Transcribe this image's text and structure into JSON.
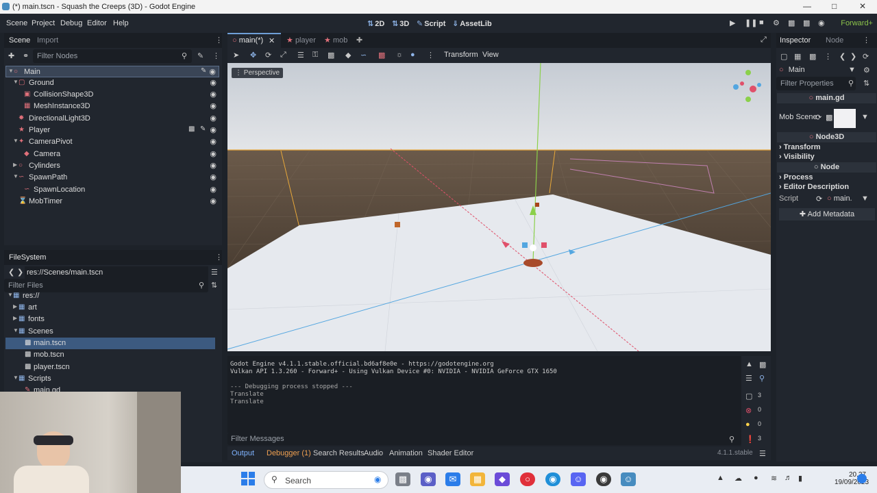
{
  "window": {
    "title": "(*) main.tscn - Squash the Creeps (3D) - Godot Engine"
  },
  "menu": {
    "items": [
      "Scene",
      "Project",
      "Debug",
      "Editor",
      "Help"
    ]
  },
  "workspaces": {
    "twod": "2D",
    "threed": "3D",
    "script": "Script",
    "assetlib": "AssetLib"
  },
  "renderer": "Forward+",
  "scene_dock": {
    "tabs": [
      "Scene",
      "Import"
    ],
    "filter_placeholder": "Filter Nodes",
    "nodes": [
      {
        "label": "Main",
        "icon_color": "#e0707a",
        "icon": "circle-node-icon"
      },
      {
        "label": "Ground",
        "icon_color": "#e0707a",
        "icon": "static-body-icon"
      },
      {
        "label": "CollisionShape3D",
        "icon_color": "#e0707a",
        "icon": "collision-shape-icon"
      },
      {
        "label": "MeshInstance3D",
        "icon_color": "#e0707a",
        "icon": "mesh-instance-icon"
      },
      {
        "label": "DirectionalLight3D",
        "icon_color": "#e0707a",
        "icon": "light-icon"
      },
      {
        "label": "Player",
        "icon_color": "#e0707a",
        "icon": "character-body-icon"
      },
      {
        "label": "CameraPivot",
        "icon_color": "#e0707a",
        "icon": "marker-icon"
      },
      {
        "label": "Camera",
        "icon_color": "#e0707a",
        "icon": "camera-icon"
      },
      {
        "label": "Cylinders",
        "icon_color": "#e0707a",
        "icon": "node3d-icon"
      },
      {
        "label": "SpawnPath",
        "icon_color": "#e0707a",
        "icon": "path-icon"
      },
      {
        "label": "SpawnLocation",
        "icon_color": "#e0707a",
        "icon": "path-follow-icon"
      },
      {
        "label": "MobTimer",
        "icon_color": "#dcdcdc",
        "icon": "timer-icon"
      }
    ]
  },
  "filesystem": {
    "title": "FileSystem",
    "path": "res://Scenes/main.tscn",
    "filter_placeholder": "Filter Files",
    "items": [
      {
        "label": "res://",
        "type": "folder"
      },
      {
        "label": "art",
        "type": "folder"
      },
      {
        "label": "fonts",
        "type": "folder"
      },
      {
        "label": "Scenes",
        "type": "folder"
      },
      {
        "label": "main.tscn",
        "type": "scene"
      },
      {
        "label": "mob.tscn",
        "type": "scene"
      },
      {
        "label": "player.tscn",
        "type": "scene"
      },
      {
        "label": "Scripts",
        "type": "folder"
      },
      {
        "label": "main.gd",
        "type": "script"
      }
    ]
  },
  "doc_tabs": [
    {
      "label": "main(*)"
    },
    {
      "label": "player"
    },
    {
      "label": "mob"
    }
  ],
  "viewport_toolbar": {
    "transform": "Transform",
    "view": "View",
    "perspective": "Perspective"
  },
  "output": {
    "lines": [
      "Godot Engine v4.1.1.stable.official.bd6af8e0e - https://godotengine.org",
      "Vulkan API 1.3.260 - Forward+ - Using Vulkan Device #0: NVIDIA - NVIDIA GeForce GTX 1650",
      "",
      "--- Debugging process stopped ---",
      "Translate",
      "Translate"
    ],
    "counts": [
      "3",
      "0",
      "0",
      "3"
    ],
    "filter_placeholder": "Filter Messages"
  },
  "bottom_tabs": [
    "Output",
    "Debugger (1)",
    "Search Results",
    "Audio",
    "Animation",
    "Shader Editor"
  ],
  "version": "4.1.1.stable",
  "inspector": {
    "tabs": [
      "Inspector",
      "Node"
    ],
    "object": "Main",
    "filter_placeholder": "Filter Properties",
    "script_name": "main.gd",
    "mob_scene_label": "Mob Scene",
    "node3d": "Node3D",
    "transform": "Transform",
    "visibility": "Visibility",
    "node": "Node",
    "process": "Process",
    "editor_description": "Editor Description",
    "script_label": "Script",
    "script_value": "main.",
    "add_metadata": "Add Metadata"
  },
  "taskbar": {
    "search": "Search",
    "time": "20.27",
    "date": "19/09/2023"
  }
}
